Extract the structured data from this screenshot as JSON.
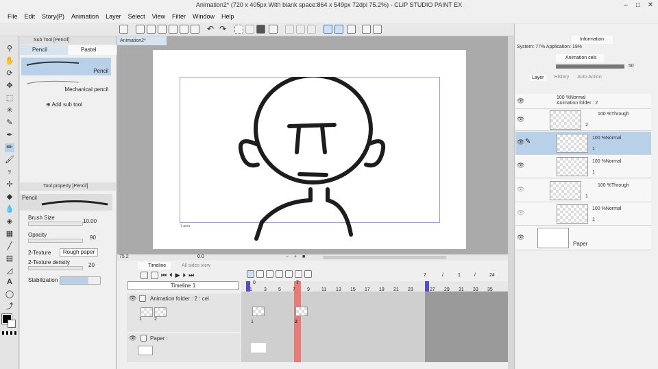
{
  "window": {
    "title": "Animation2* (720 x 405px With blank space:864 x 549px 72dpi 75.2%) - CLIP STUDIO PAINT EX"
  },
  "menu": [
    "File",
    "Edit",
    "Story(P)",
    "Animation",
    "Layer",
    "Select",
    "View",
    "Filter",
    "Window",
    "Help"
  ],
  "subtool": {
    "panel_title": "Sub Tool [Pencil]",
    "tabs": [
      "Pencil",
      "Pastel"
    ],
    "items": [
      "Pencil",
      "Mechanical pencil"
    ],
    "add_label": "Add sub tool"
  },
  "toolprop": {
    "panel_title": "Tool property [Pencil]",
    "brush_name": "Pencil",
    "brush_size_label": "Brush Size",
    "brush_size_value": "10.00",
    "opacity_label": "Opacity",
    "opacity_value": "90",
    "texture_label": "2-Texture",
    "texture_value": "Rough paper",
    "texture_density_label": "2-Texture density",
    "texture_density_value": "20",
    "stabilization_label": "Stabilization"
  },
  "canvas": {
    "tab": "Animation2*",
    "zoom": "75.2",
    "angle": "0.0",
    "frame_label": "1 area"
  },
  "timeline": {
    "tab": "Timeline",
    "tab2": "All sides view",
    "name": "Timeline 1",
    "frame_total": "24",
    "frame_sep": "/",
    "frame_sep2": "/",
    "current_frame": "7",
    "current_total": "1",
    "ruler": [
      "1",
      "3",
      "5",
      "7",
      "9",
      "11",
      "13",
      "15",
      "17",
      "19",
      "21",
      "23",
      "27",
      "29",
      "31",
      "33",
      "35"
    ],
    "start_marker": "0",
    "playhead": "7",
    "tracks": [
      {
        "name": "Animation folder : 2 : cel",
        "cels": [
          "1",
          "2"
        ]
      },
      {
        "name": "Paper :"
      }
    ],
    "cel_marks": [
      "1",
      "2"
    ]
  },
  "rpanel": {
    "sys_text": "System: 77% Application: 19%",
    "info_tab": "Information",
    "anim_cels_tab": "Animation cels",
    "opacity": "50",
    "layer_tabs": [
      "Layer",
      "History",
      "Auto Action"
    ]
  },
  "layers": [
    {
      "mode": "100 %Normal",
      "name": "Animation folder : 2"
    },
    {
      "mode": "100 %Through",
      "name": "2"
    },
    {
      "mode": "100 %Normal",
      "name": "1"
    },
    {
      "mode": "100 %Normal",
      "name": "1"
    },
    {
      "mode": "100 %Through",
      "name": "1"
    },
    {
      "mode": "100 %Normal",
      "name": "1"
    },
    {
      "mode": "",
      "name": "Paper"
    }
  ],
  "colors": {
    "accent": "#b8d0e8",
    "playhead": "#e87a7a",
    "marker": "#5050c0"
  }
}
